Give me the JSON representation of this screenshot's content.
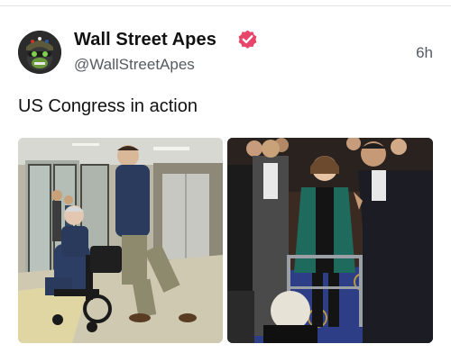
{
  "post": {
    "author": {
      "name": "Wall Street Apes",
      "handle": "@WallStreetApes",
      "verified": true,
      "avatar_icon": "gorilla-avatar-icon"
    },
    "timestamp": "6h",
    "text": "US Congress in action",
    "media": [
      {
        "icon": "photo-wheelchair-hallway"
      },
      {
        "icon": "photo-walker-chamber"
      }
    ]
  },
  "colors": {
    "text_primary": "#111111",
    "text_secondary": "#555b61",
    "verified_badge": "#e8456b",
    "divider": "#e6e6e6"
  }
}
